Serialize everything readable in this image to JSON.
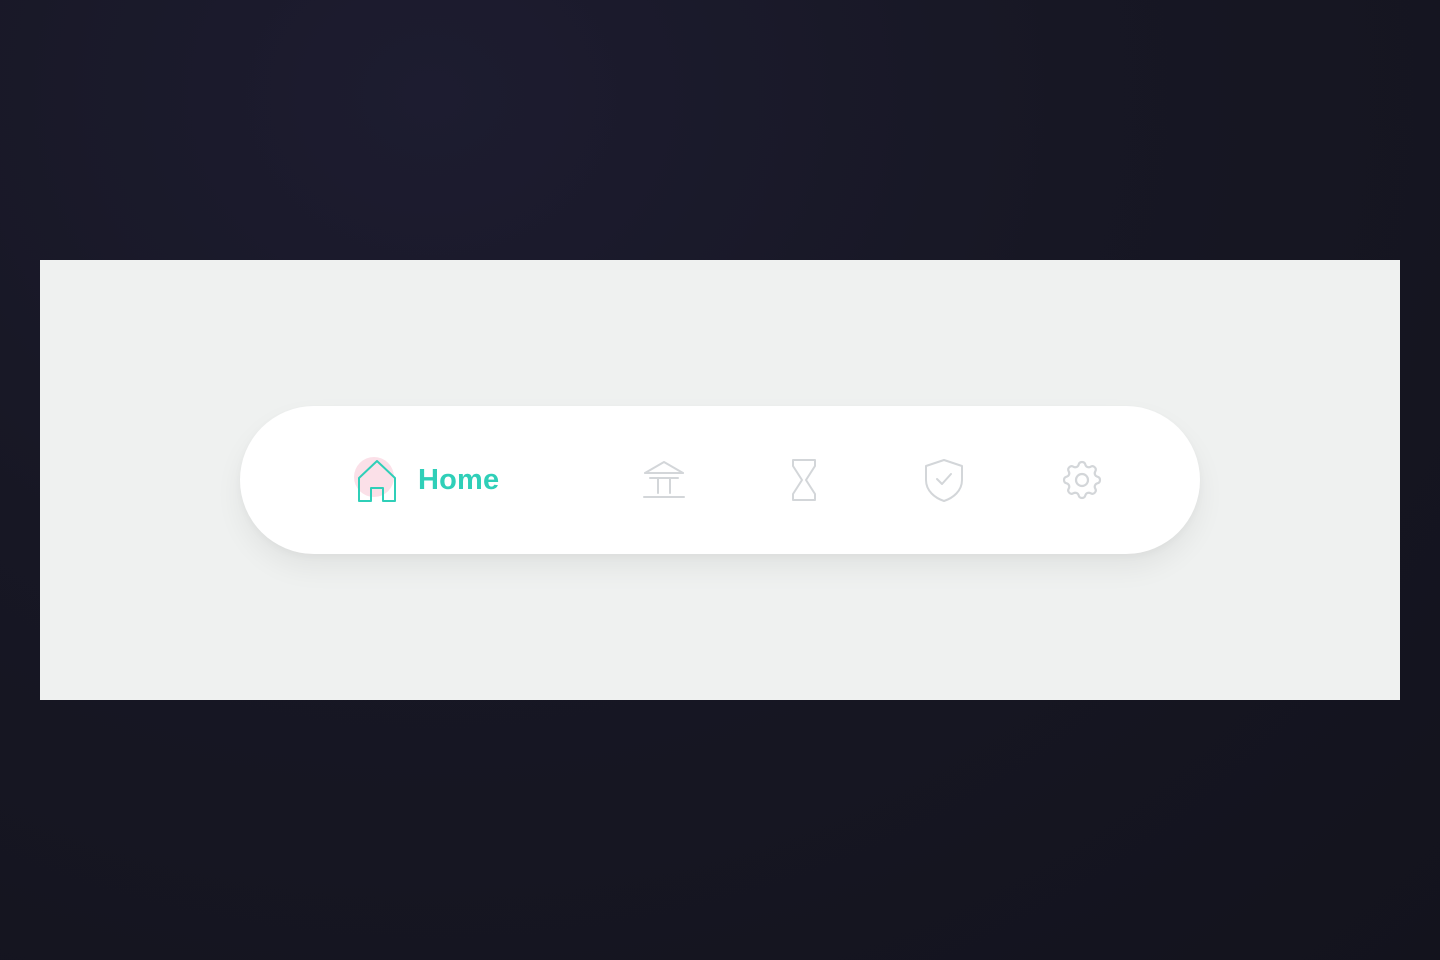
{
  "colors": {
    "active": "#2fcfb8",
    "inactive": "#d3d6d9",
    "highlight": "#fbe0e8"
  },
  "nav": {
    "items": [
      {
        "icon": "home-icon",
        "label": "Home",
        "active": true
      },
      {
        "icon": "bank-icon",
        "active": false
      },
      {
        "icon": "hourglass-icon",
        "active": false
      },
      {
        "icon": "shield-check-icon",
        "active": false
      },
      {
        "icon": "gear-icon",
        "active": false
      }
    ]
  }
}
